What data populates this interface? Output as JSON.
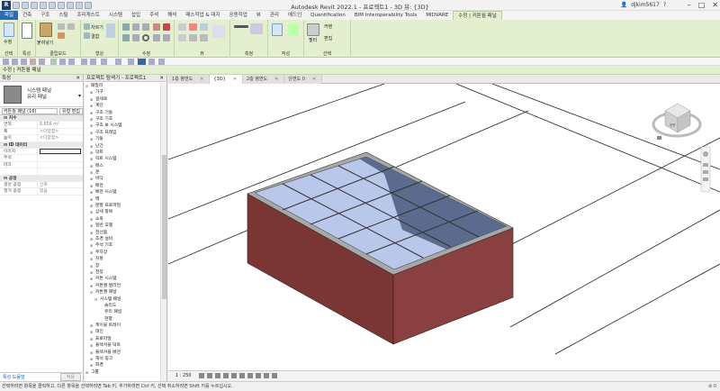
{
  "app_title": "Autodesk Revit 2022.1 - 프로젝트1 - 3D 뷰: {3D}",
  "user": {
    "name": "djkim5617",
    "help": "?"
  },
  "ribbon_tabs": [
    "파일",
    "건축",
    "구조",
    "스틸",
    "프리캐스트",
    "시스템",
    "삽입",
    "주석",
    "해석",
    "매스작업 & 대지",
    "공동작업",
    "뷰",
    "관리",
    "애드인",
    "Quantification",
    "BIM Interoperability Tools",
    "MIDVARE",
    "수정 | 커튼월 패널"
  ],
  "ribbon_panels": {
    "select": {
      "label": "선택",
      "button": "수정"
    },
    "properties": {
      "label": "특성"
    },
    "clipboard": {
      "label": "클립보드",
      "paste": "붙여넣기"
    },
    "geometry": {
      "label": "형상",
      "cut": "자르기",
      "join": "결합"
    },
    "modify": {
      "label": "수정"
    },
    "view": {
      "label": "뷰"
    },
    "measure": {
      "label": "측정"
    },
    "create": {
      "label": "작성"
    },
    "filter_group": {
      "label": "선택",
      "item1": "커텐",
      "item2": "필터",
      "item3": "편집"
    }
  },
  "context_bar": "수정 | 커튼월 패널",
  "properties": {
    "header": "특성",
    "type_line1": "시스템 패널",
    "type_line2": "유리 패널",
    "selector": "커튼월 패널 (16)",
    "edit_type": "유형 편집",
    "rows": [
      {
        "k": "치수",
        "v": "",
        "sec": true
      },
      {
        "k": "면적",
        "v": "8.656 m²"
      },
      {
        "k": "폭",
        "v": "<다양함>"
      },
      {
        "k": "높이",
        "v": "<다양함>"
      },
      {
        "k": "ID 데이터",
        "v": "",
        "sec": true
      },
      {
        "k": "이미지",
        "v": "",
        "box": true
      },
      {
        "k": "주석",
        "v": ""
      },
      {
        "k": "마크",
        "v": ""
      },
      {
        "k": "",
        "v": ""
      },
      {
        "k": "공정",
        "v": "",
        "sec": true
      },
      {
        "k": "생성 공정",
        "v": "신축"
      },
      {
        "k": "철거 공정",
        "v": "없음"
      }
    ],
    "help_link": "특성 도움말",
    "apply": "적용"
  },
  "browser": {
    "header": "프로젝트 탐색기 - 프로젝트1",
    "items": [
      {
        "label": "패밀리",
        "lvl": 0,
        "t": "⊟"
      },
      {
        "label": "가구",
        "lvl": 1,
        "t": "⊞"
      },
      {
        "label": "걸세로",
        "lvl": 1,
        "t": "⊞"
      },
      {
        "label": "계단",
        "lvl": 1,
        "t": "⊞"
      },
      {
        "label": "구조 기둥",
        "lvl": 1,
        "t": "⊞"
      },
      {
        "label": "구조 기초",
        "lvl": 1,
        "t": "⊞"
      },
      {
        "label": "구조 보 시스템",
        "lvl": 1,
        "t": "⊞"
      },
      {
        "label": "구조 프레임",
        "lvl": 1,
        "t": "⊞"
      },
      {
        "label": "기둥",
        "lvl": 1,
        "t": "⊞"
      },
      {
        "label": "난간",
        "lvl": 1,
        "t": "⊞"
      },
      {
        "label": "덕트",
        "lvl": 1,
        "t": "⊞"
      },
      {
        "label": "덕트 시스템",
        "lvl": 1,
        "t": "⊞"
      },
      {
        "label": "매스",
        "lvl": 1,
        "t": "⊞"
      },
      {
        "label": "문",
        "lvl": 1,
        "t": "⊞"
      },
      {
        "label": "바닥",
        "lvl": 1,
        "t": "⊞"
      },
      {
        "label": "배관",
        "lvl": 1,
        "t": "⊞"
      },
      {
        "label": "배관 시스템",
        "lvl": 1,
        "t": "⊞"
      },
      {
        "label": "벽",
        "lvl": 1,
        "t": "⊞"
      },
      {
        "label": "분할 프로파일",
        "lvl": 1,
        "t": "⊞"
      },
      {
        "label": "상세 항목",
        "lvl": 1,
        "t": "⊞"
      },
      {
        "label": "소옥",
        "lvl": 1,
        "t": "⊞"
      },
      {
        "label": "일반 모델",
        "lvl": 1,
        "t": "⊞"
      },
      {
        "label": "천선돔",
        "lvl": 1,
        "t": "⊞"
      },
      {
        "label": "조경 설비",
        "lvl": 1,
        "t": "⊞"
      },
      {
        "label": "주석 기호",
        "lvl": 1,
        "t": "⊞"
      },
      {
        "label": "주차장",
        "lvl": 1,
        "t": "⊞"
      },
      {
        "label": "지붕",
        "lvl": 1,
        "t": "⊞"
      },
      {
        "label": "창",
        "lvl": 1,
        "t": "⊞"
      },
      {
        "label": "천장",
        "lvl": 1,
        "t": "⊞"
      },
      {
        "label": "커튼 시스템",
        "lvl": 1,
        "t": "⊞"
      },
      {
        "label": "커튼월 멀리언",
        "lvl": 1,
        "t": "⊞"
      },
      {
        "label": "커튼월 패널",
        "lvl": 1,
        "t": "⊟"
      },
      {
        "label": "시스템 패널",
        "lvl": 2,
        "t": "⊟"
      },
      {
        "label": "솔리드",
        "lvl": 3,
        "t": ""
      },
      {
        "label": "유리 패널",
        "lvl": 3,
        "t": ""
      },
      {
        "label": "현향",
        "lvl": 3,
        "t": ""
      },
      {
        "label": "케이블 트레이",
        "lvl": 1,
        "t": "⊞"
      },
      {
        "label": "태진",
        "lvl": 1,
        "t": "⊞"
      },
      {
        "label": "프로파일",
        "lvl": 1,
        "t": "⊞"
      },
      {
        "label": "플렉서블 덕트",
        "lvl": 1,
        "t": "⊞"
      },
      {
        "label": "플렉서블 배관",
        "lvl": 1,
        "t": "⊞"
      },
      {
        "label": "해석 링크",
        "lvl": 1,
        "t": "⊞"
      },
      {
        "label": "화경",
        "lvl": 1,
        "t": "⊞"
      },
      {
        "label": "그룹",
        "lvl": 0,
        "t": "⊞"
      }
    ]
  },
  "view_tabs": [
    {
      "label": "1층 평면도",
      "active": false
    },
    {
      "label": "{3D}",
      "active": true
    },
    {
      "label": "2층 평면도",
      "active": false
    },
    {
      "label": "단면도 0",
      "active": false
    }
  ],
  "viewcube": {
    "face": "정면"
  },
  "view_control": {
    "scale": "1 : 250"
  },
  "status_text": "선택하려면 항목을 클릭하고, 다른 항목을 선택하려면 Tab 키, 추가하려면 Ctrl 키, 선택 취소하려면 Shift 키를 누르십시오.",
  "status_right": "⊘ 0",
  "colors": {
    "ribbon": "#e4efcf",
    "wall": "#7a3535",
    "glass": "#b8c7ea",
    "glass_dark": "#4a5a7c"
  }
}
